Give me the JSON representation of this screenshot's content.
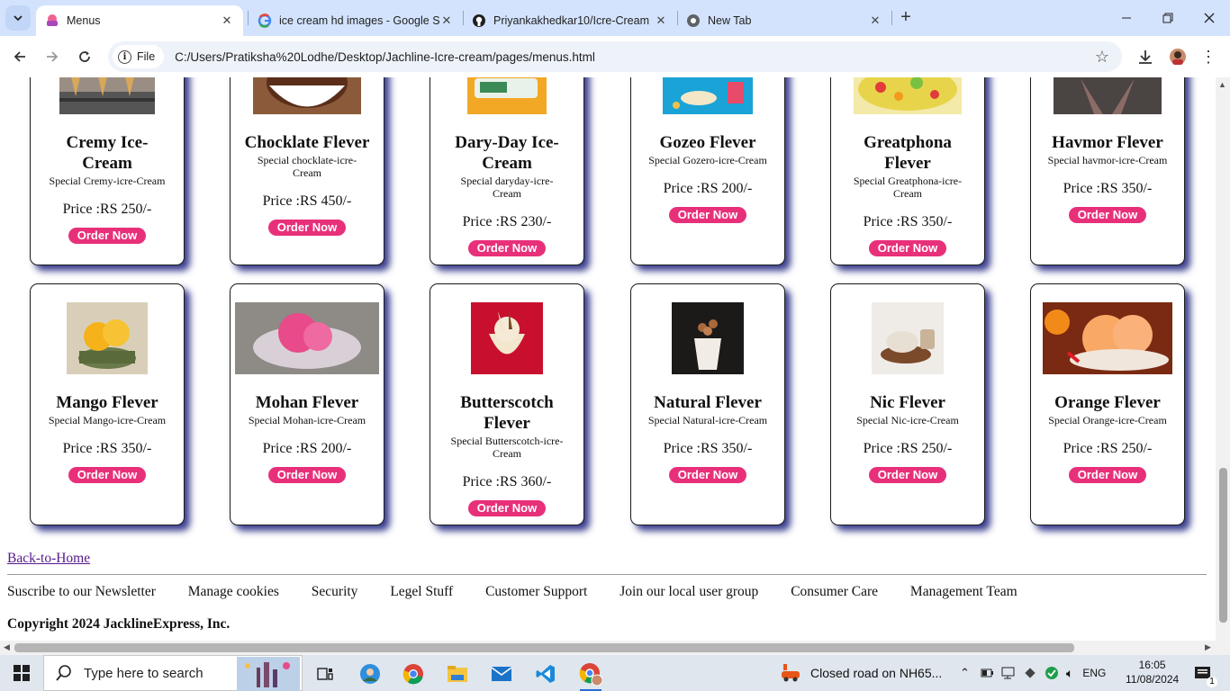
{
  "browser": {
    "tabs": [
      {
        "title": "Menus",
        "active": true
      },
      {
        "title": "ice cream hd images - Google S",
        "active": false
      },
      {
        "title": "Priyankakhedkar10/Icre-Cream",
        "active": false
      },
      {
        "title": "New Tab",
        "active": false
      }
    ],
    "chip_label": "File",
    "url": "C:/Users/Pratiksha%20Lodhe/Desktop/Jachline-Icre-cream/pages/menus.html"
  },
  "order_label": "Order Now",
  "cards_top": [
    {
      "name": "Cremy Ice-Cream",
      "sub": "Special Cremy-icre-Cream",
      "price": "Price :RS 250/-"
    },
    {
      "name": "Chocklate Flever",
      "sub": "Special chocklate-icre-Cream",
      "price": "Price :RS 450/-"
    },
    {
      "name": "Dary-Day Ice-Cream",
      "sub": "Special daryday-icre-Cream",
      "price": "Price :RS 230/-"
    },
    {
      "name": "Gozeo Flever",
      "sub": "Special Gozero-icre-Cream",
      "price": "Price :RS 200/-"
    },
    {
      "name": "Greatphona Flever",
      "sub": "Special Greatphona-icre-Cream",
      "price": "Price :RS 350/-"
    },
    {
      "name": "Havmor Flever",
      "sub": "Special havmor-icre-Cream",
      "price": "Price :RS 350/-"
    }
  ],
  "cards_bottom": [
    {
      "name": "Mango Flever",
      "sub": "Special Mango-icre-Cream",
      "price": "Price :RS 350/-"
    },
    {
      "name": "Mohan Flever",
      "sub": "Special Mohan-icre-Cream",
      "price": "Price :RS 200/-"
    },
    {
      "name": "Butterscotch Flever",
      "sub": "Special Butterscotch-icre-Cream",
      "price": "Price :RS 360/-"
    },
    {
      "name": "Natural Flever",
      "sub": "Special Natural-icre-Cream",
      "price": "Price :RS 350/-"
    },
    {
      "name": "Nic Flever",
      "sub": "Special Nic-icre-Cream",
      "price": "Price :RS 250/-"
    },
    {
      "name": "Orange Flever",
      "sub": "Special Orange-icre-Cream",
      "price": "Price :RS 250/-"
    }
  ],
  "back_link": "Back-to-Home",
  "footer_links": [
    "Suscribe to our Newsletter",
    "Manage cookies",
    "Security",
    "Legel Stuff",
    "Customer Support",
    "Join our local user group",
    "Consumer Care",
    "Management Team"
  ],
  "copyright": "Copyright 2024 JacklineExpress, Inc.",
  "taskbar": {
    "search_placeholder": "Type here to search",
    "notification": "Closed road on NH65...",
    "language": "ENG",
    "time": "16:05",
    "date": "11/08/2024",
    "notification_count": "1"
  },
  "colors": {
    "order_button": "#e8307a",
    "card_shadow": "#3a3f8f",
    "link_visited": "#551a8b"
  }
}
